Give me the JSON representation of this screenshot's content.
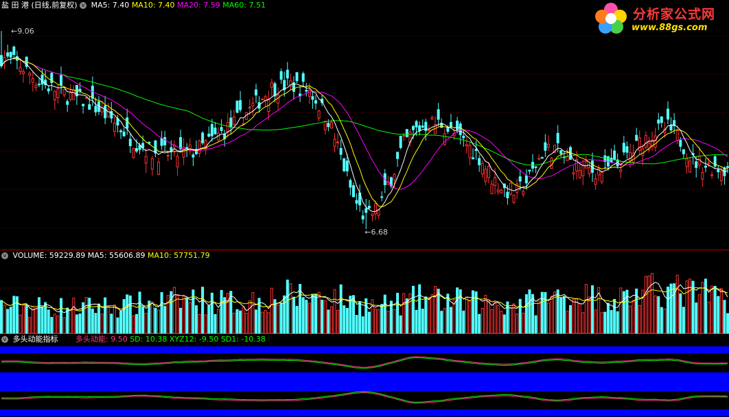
{
  "header": {
    "stock_name": "盐 田 港",
    "period": "(日线,前复权)",
    "ma_items": [
      {
        "label": "MA5: 7.40",
        "color": "#ffffff"
      },
      {
        "label": "MA10: 7.40",
        "color": "#ffff00"
      },
      {
        "label": "MA20: 7.59",
        "color": "#ff00ff"
      },
      {
        "label": "MA60: 7.51",
        "color": "#00ff00"
      }
    ],
    "high_marker": "9.06",
    "low_marker": "6.68"
  },
  "volume_panel": {
    "items": [
      {
        "label": "VOLUME: 59229.89",
        "color": "#ffffff"
      },
      {
        "label": "MA5: 55606.89",
        "color": "#ffffff"
      },
      {
        "label": "MA10: 57751.79",
        "color": "#ffff00"
      }
    ]
  },
  "indicator_panel": {
    "name": "多头动能指标",
    "items": [
      {
        "label": "多头动能: 9.50",
        "color": "#ff3a8a"
      },
      {
        "label": "SD: 10.38",
        "color": "#00ff00"
      },
      {
        "label": "XYZ12: -9.50",
        "color": "#00ff00"
      },
      {
        "label": "SD1: -10.38",
        "color": "#00ff00"
      }
    ]
  },
  "logo": {
    "title": "分析家公式网",
    "url": "www.88gs.com"
  },
  "colors": {
    "up": "#ff3232",
    "down": "#54ffff",
    "ma5": "#ffffff",
    "ma10": "#ffff00",
    "ma20": "#ff00ff",
    "ma60": "#00ff00",
    "band": "#0000ff",
    "grid": "#8b0000"
  },
  "chart_data": {
    "type": "candlestick",
    "title": "盐 田 港 (日线,前复权)",
    "price_range": [
      6.45,
      9.3
    ],
    "marked_high": 9.06,
    "marked_low": 6.68,
    "last": {
      "MA5": 7.4,
      "MA10": 7.4,
      "MA20": 7.59,
      "MA60": 7.51,
      "VOLUME": 59229.89,
      "VOL_MA5": 55606.89,
      "VOL_MA10": 57751.79,
      "多头动能": 9.5,
      "SD": 10.38,
      "XYZ12": -9.5,
      "SD1": -10.38
    },
    "close_keypoints": [
      [
        0,
        8.75
      ],
      [
        6,
        8.65
      ],
      [
        12,
        8.45
      ],
      [
        20,
        8.3
      ],
      [
        28,
        8.2
      ],
      [
        35,
        8.0
      ],
      [
        42,
        7.75
      ],
      [
        48,
        7.6
      ],
      [
        55,
        7.58
      ],
      [
        62,
        7.62
      ],
      [
        68,
        7.78
      ],
      [
        74,
        7.95
      ],
      [
        80,
        8.15
      ],
      [
        86,
        8.38
      ],
      [
        92,
        8.42
      ],
      [
        98,
        8.35
      ],
      [
        104,
        8.0
      ],
      [
        108,
        7.55
      ],
      [
        112,
        7.05
      ],
      [
        116,
        6.8
      ],
      [
        120,
        6.95
      ],
      [
        124,
        7.3
      ],
      [
        128,
        7.7
      ],
      [
        132,
        7.88
      ],
      [
        136,
        7.95
      ],
      [
        140,
        7.95
      ],
      [
        144,
        7.82
      ],
      [
        148,
        7.7
      ],
      [
        152,
        7.55
      ],
      [
        156,
        7.3
      ],
      [
        160,
        7.15
      ],
      [
        164,
        7.12
      ],
      [
        168,
        7.3
      ],
      [
        172,
        7.6
      ],
      [
        176,
        7.65
      ],
      [
        180,
        7.5
      ],
      [
        184,
        7.42
      ],
      [
        188,
        7.38
      ],
      [
        192,
        7.4
      ],
      [
        196,
        7.45
      ],
      [
        200,
        7.58
      ],
      [
        204,
        7.75
      ],
      [
        208,
        7.85
      ],
      [
        212,
        7.9
      ],
      [
        216,
        7.75
      ],
      [
        220,
        7.5
      ],
      [
        224,
        7.45
      ],
      [
        228,
        7.42
      ],
      [
        231,
        7.4
      ]
    ],
    "volume_levels": [
      [
        0,
        45000
      ],
      [
        20,
        42000
      ],
      [
        40,
        45000
      ],
      [
        60,
        56000
      ],
      [
        75,
        50000
      ],
      [
        90,
        62000
      ],
      [
        105,
        60000
      ],
      [
        120,
        42000
      ],
      [
        135,
        58000
      ],
      [
        150,
        50000
      ],
      [
        165,
        48000
      ],
      [
        180,
        62000
      ],
      [
        195,
        56000
      ],
      [
        210,
        72000
      ],
      [
        225,
        62000
      ],
      [
        231,
        59230
      ]
    ],
    "volume_max": 120000,
    "indicator_range": [
      -20,
      20
    ],
    "count": 232
  }
}
